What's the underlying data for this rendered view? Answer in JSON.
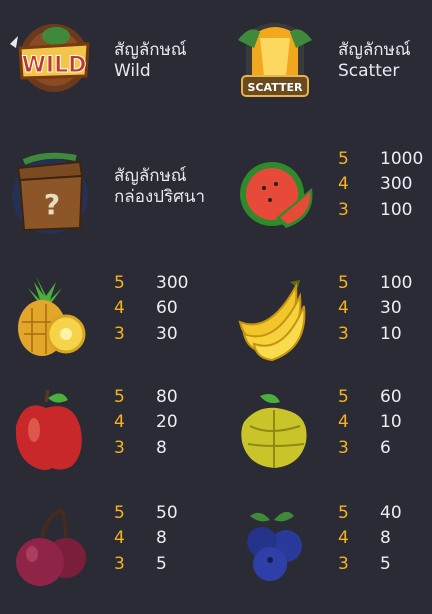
{
  "symbols": [
    {
      "icon": "wild-coconut-icon",
      "title_line1": "สัญลักษณ์",
      "title_line2": "Wild",
      "icon_text": "WILD"
    },
    {
      "icon": "scatter-temple-icon",
      "title_line1": "สัญลักษณ์",
      "title_line2": "Scatter",
      "icon_text": "SCATTER"
    },
    {
      "icon": "mystery-box-icon",
      "title_line1": "สัญลักษณ์",
      "title_line2": "กล่องปริศนา",
      "icon_text": "?"
    },
    {
      "icon": "watermelon-icon",
      "pays": [
        {
          "count": "5",
          "value": "1000"
        },
        {
          "count": "4",
          "value": "300"
        },
        {
          "count": "3",
          "value": "100"
        }
      ]
    },
    {
      "icon": "pineapple-icon",
      "pays": [
        {
          "count": "5",
          "value": "300"
        },
        {
          "count": "4",
          "value": "60"
        },
        {
          "count": "3",
          "value": "30"
        }
      ]
    },
    {
      "icon": "banana-icon",
      "pays": [
        {
          "count": "5",
          "value": "100"
        },
        {
          "count": "4",
          "value": "30"
        },
        {
          "count": "3",
          "value": "10"
        }
      ]
    },
    {
      "icon": "apple-icon",
      "pays": [
        {
          "count": "5",
          "value": "80"
        },
        {
          "count": "4",
          "value": "20"
        },
        {
          "count": "3",
          "value": "8"
        }
      ]
    },
    {
      "icon": "starfruit-icon",
      "pays": [
        {
          "count": "5",
          "value": "60"
        },
        {
          "count": "4",
          "value": "10"
        },
        {
          "count": "3",
          "value": "6"
        }
      ]
    },
    {
      "icon": "plum-icon",
      "pays": [
        {
          "count": "5",
          "value": "50"
        },
        {
          "count": "4",
          "value": "8"
        },
        {
          "count": "3",
          "value": "5"
        }
      ]
    },
    {
      "icon": "blueberry-icon",
      "pays": [
        {
          "count": "5",
          "value": "40"
        },
        {
          "count": "4",
          "value": "8"
        },
        {
          "count": "3",
          "value": "5"
        }
      ]
    }
  ],
  "colors": {
    "background": "#2b2b35",
    "count": "#f5b320",
    "value": "#ececf2"
  }
}
